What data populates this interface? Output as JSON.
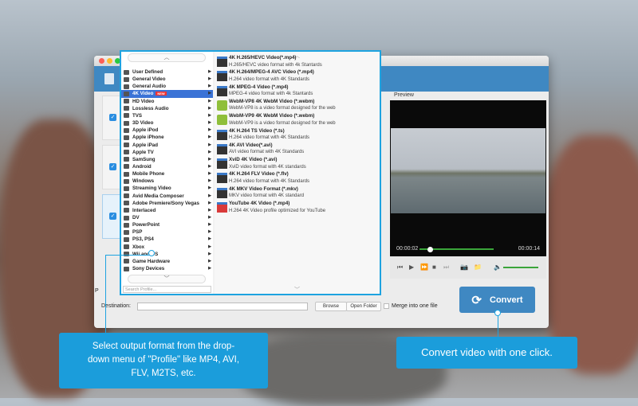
{
  "profile_menu": {
    "categories": [
      {
        "label": "User Defined",
        "icon": "user-icon"
      },
      {
        "label": "General Video",
        "icon": "film-icon"
      },
      {
        "label": "General Audio",
        "icon": "music-icon"
      },
      {
        "label": "4K Video",
        "icon": "4k-icon",
        "badge": "NEW",
        "selected": true
      },
      {
        "label": "HD Video",
        "icon": "hd-icon"
      },
      {
        "label": "Lossless Audio",
        "icon": "music-note-icon"
      },
      {
        "label": "TVS",
        "icon": "tv-icon"
      },
      {
        "label": "3D Video",
        "icon": "3d-icon"
      },
      {
        "label": "Apple iPod",
        "icon": "ipod-icon"
      },
      {
        "label": "Apple iPhone",
        "icon": "iphone-icon"
      },
      {
        "label": "Apple iPad",
        "icon": "ipad-icon"
      },
      {
        "label": "Apple TV",
        "icon": "appletv-icon"
      },
      {
        "label": "SamSung",
        "icon": "phone-icon"
      },
      {
        "label": "Android",
        "icon": "android-icon"
      },
      {
        "label": "Mobile Phone",
        "icon": "mobile-icon"
      },
      {
        "label": "Windows",
        "icon": "windows-icon"
      },
      {
        "label": "Streaming Video",
        "icon": "globe-icon"
      },
      {
        "label": "Avid Media Composer",
        "icon": "avid-icon"
      },
      {
        "label": "Adobe Premiere/Sony Vegas",
        "icon": "adobe-icon"
      },
      {
        "label": "Interlaced",
        "icon": "interlaced-icon"
      },
      {
        "label": "DV",
        "icon": "dv-icon"
      },
      {
        "label": "PowerPoint",
        "icon": "powerpoint-icon"
      },
      {
        "label": "PSP",
        "icon": "psp-icon"
      },
      {
        "label": "PS3, PS4",
        "icon": "ps-icon"
      },
      {
        "label": "Xbox",
        "icon": "xbox-icon"
      },
      {
        "label": "Wii and DS",
        "icon": "nintendo-icon"
      },
      {
        "label": "Game Hardware",
        "icon": "game-icon"
      },
      {
        "label": "Sony Devices",
        "icon": "sony-icon"
      }
    ],
    "formats": [
      {
        "title": "4K H.265/HEVC Video(*.mp4)",
        "desc": "H.265/HEVC video format with 4k Stantards",
        "icon": "4k"
      },
      {
        "title": "4K H.264/MPEG-4 AVC Video (*.mp4)",
        "desc": "H.264 video format with 4K Standards",
        "icon": "4k"
      },
      {
        "title": "4K MPEG-4 Video (*.mp4)",
        "desc": "MPEG-4 video format with 4k Stantards",
        "icon": "4k"
      },
      {
        "title": "WebM-VP8 4K WebM Video (*.webm)",
        "desc": "WebM-VP8 is a video format designed for the web",
        "icon": "webm"
      },
      {
        "title": "WebM-VP9 4K WebM Video (*.webm)",
        "desc": "WebM-VP9 is a video format designed for the web",
        "icon": "webm"
      },
      {
        "title": "4K H.264 TS Video (*.ts)",
        "desc": "H.264 video format with 4K Standards",
        "icon": "4k"
      },
      {
        "title": "4K AVI Video(*.avi)",
        "desc": "AVI video format with 4K Standards",
        "icon": "4k"
      },
      {
        "title": "XviD 4K Video (*.avi)",
        "desc": "XviD video format with 4K standards",
        "icon": "4k"
      },
      {
        "title": "4K H.264 FLV Video (*.flv)",
        "desc": "H.264 video format with 4K Standards",
        "icon": "4k"
      },
      {
        "title": "4K MKV Video Format (*.mkv)",
        "desc": "MKV video format with 4K standard",
        "icon": "4k"
      },
      {
        "title": "YouTube 4K Video (*.mp4)",
        "desc": "H.264 4K Video profile optimized for YouTube",
        "icon": "yt"
      }
    ],
    "search_placeholder": "Search Profile..."
  },
  "preview": {
    "label": "Preview",
    "current_time": "00:00:02",
    "total_time": "00:00:14",
    "progress": 0.14,
    "volume": 0.9
  },
  "bottom": {
    "profile_label": "P",
    "destination_label": "Destination:",
    "destination_value": "",
    "browse": "Browse",
    "open_folder": "Open Folder",
    "merge": "Merge into one file",
    "convert": "Convert"
  },
  "callouts": {
    "left": "Select output format from the drop-down menu of \"Profile\" like MP4, AVI, FLV, M2TS, etc.",
    "right": "Convert video with one click."
  },
  "colors": {
    "accent": "#3f88c2",
    "highlight": "#1ea3e0",
    "selected": "#3b73d6"
  }
}
